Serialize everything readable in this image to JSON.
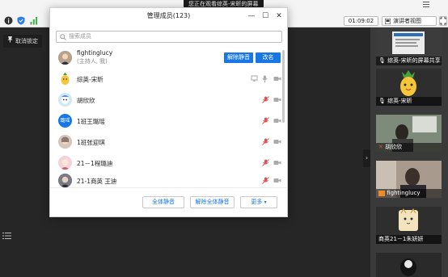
{
  "share_banner": "您正在观看综英-宋昕的屏幕",
  "toolbar": {
    "time": "01:09:02",
    "view_label": "演讲者视图"
  },
  "unlock_label": "取消锁定",
  "dialog": {
    "title": "管理成员(123)",
    "search_placeholder": "搜索成员",
    "members": [
      {
        "name": "fightinglucy",
        "sub": "(主持人, 我)",
        "avatar": "photo-woman",
        "mic_muted": false,
        "cam": false
      },
      {
        "name": "综英-宋昕",
        "sub": "",
        "avatar": "pineapple",
        "mic_muted": false,
        "cam": true
      },
      {
        "name": "胡欣欣",
        "sub": "",
        "avatar": "cartoon-blue",
        "mic_muted": true,
        "cam": true
      },
      {
        "name": "1班王璐瑶",
        "sub": "",
        "avatar": "text-璐瑶",
        "avatar_text": "璐瑶",
        "mic_muted": true,
        "cam": true
      },
      {
        "name": "1班张迎琪",
        "sub": "",
        "avatar": "photo-girl",
        "mic_muted": true,
        "cam": true
      },
      {
        "name": "21－1程璐迪",
        "sub": "",
        "avatar": "photo-pink",
        "mic_muted": true,
        "cam": true
      },
      {
        "name": "21-1商英 王迪",
        "sub": "",
        "avatar": "photo-dark",
        "mic_muted": true,
        "cam": true
      }
    ],
    "unmute_label": "解除静音",
    "rename_label": "改名",
    "mute_all": "全体静音",
    "unmute_all": "解除全体静音",
    "more": "更多"
  },
  "tiles": [
    {
      "label": "综英-宋昕的屏幕共享",
      "kind": "screen"
    },
    {
      "label": "综英-宋昕",
      "kind": "pineapple"
    },
    {
      "label": "胡欣欣",
      "kind": "video"
    },
    {
      "label": "fightinglucy",
      "kind": "video-orange"
    },
    {
      "label": "商英21－1朱妍妍",
      "kind": "cat"
    },
    {
      "label": "",
      "kind": "video-dark"
    }
  ],
  "colors": {
    "accent": "#1677e5",
    "muted_red": "#e84d4d"
  }
}
